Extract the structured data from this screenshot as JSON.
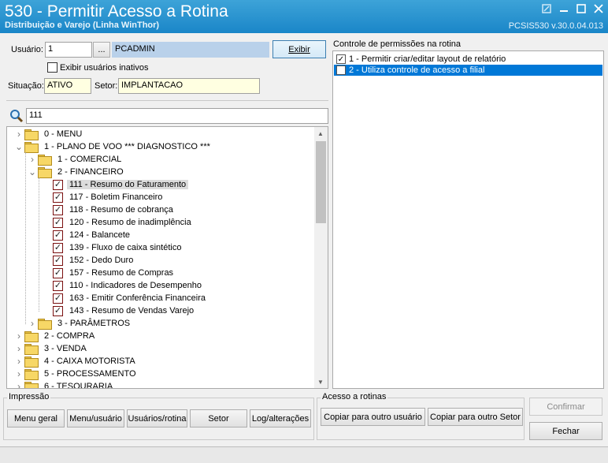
{
  "window": {
    "title": "530 - Permitir Acesso a Rotina",
    "subtitle": "Distribuição e Varejo (Linha WinThor)",
    "version": "PCSIS530  v.30.0.04.013"
  },
  "form": {
    "usuario_label": "Usuário:",
    "usuario_value": "1",
    "lookup_label": "...",
    "usuario_name": "PCADMIN",
    "exibir_label": "Exibir",
    "inativos_label": "Exibir usuários inativos",
    "situacao_label": "Situação:",
    "situacao_value": "ATIVO",
    "setor_label": "Setor:",
    "setor_value": "IMPLANTACAO",
    "search_value": "111"
  },
  "tree": [
    {
      "label": "0 - MENU",
      "level": 0,
      "kind": "folder",
      "arrow": "collapsed"
    },
    {
      "label": "1 - PLANO DE VOO   *** DIAGNOSTICO ***",
      "level": 0,
      "kind": "folder",
      "arrow": "expanded"
    },
    {
      "label": "1 - COMERCIAL",
      "level": 1,
      "kind": "folder",
      "arrow": "collapsed"
    },
    {
      "label": "2 - FINANCEIRO",
      "level": 1,
      "kind": "folder",
      "arrow": "expanded"
    },
    {
      "label": "111 - Resumo do Faturamento",
      "level": 2,
      "kind": "check",
      "checked": true,
      "selected": true
    },
    {
      "label": "117 - Boletim Financeiro",
      "level": 2,
      "kind": "check",
      "checked": true
    },
    {
      "label": "118 - Resumo de cobrança",
      "level": 2,
      "kind": "check",
      "checked": true
    },
    {
      "label": "120 - Resumo de inadimplência",
      "level": 2,
      "kind": "check",
      "checked": true
    },
    {
      "label": "124 - Balancete",
      "level": 2,
      "kind": "check",
      "checked": true
    },
    {
      "label": "139 - Fluxo de caixa sintético",
      "level": 2,
      "kind": "check",
      "checked": true
    },
    {
      "label": "152 - Dedo Duro",
      "level": 2,
      "kind": "check",
      "checked": true
    },
    {
      "label": "157 - Resumo de Compras",
      "level": 2,
      "kind": "check",
      "checked": true
    },
    {
      "label": "110 - Indicadores de Desempenho",
      "level": 2,
      "kind": "check",
      "checked": true
    },
    {
      "label": "163 - Emitir Conferência Financeira",
      "level": 2,
      "kind": "check",
      "checked": true
    },
    {
      "label": "143 - Resumo de Vendas Varejo",
      "level": 2,
      "kind": "check",
      "checked": true
    },
    {
      "label": "3 - PARÂMETROS",
      "level": 1,
      "kind": "folder",
      "arrow": "collapsed"
    },
    {
      "label": "2 - COMPRA",
      "level": 0,
      "kind": "folder",
      "arrow": "collapsed"
    },
    {
      "label": "3 - VENDA",
      "level": 0,
      "kind": "folder",
      "arrow": "collapsed"
    },
    {
      "label": "4 - CAIXA MOTORISTA",
      "level": 0,
      "kind": "folder",
      "arrow": "collapsed"
    },
    {
      "label": "5 - PROCESSAMENTO",
      "level": 0,
      "kind": "folder",
      "arrow": "collapsed"
    },
    {
      "label": "6 - TESOURARIA",
      "level": 0,
      "kind": "folder",
      "arrow": "collapsed"
    }
  ],
  "permissions": {
    "title": "Controle de permissões na rotina",
    "items": [
      {
        "label": "1 - Permitir criar/editar layout de relatório",
        "checked": true,
        "selected": false
      },
      {
        "label": "2 - Utiliza controle de acesso a filial",
        "checked": false,
        "selected": true
      }
    ]
  },
  "impressao": {
    "title": "Impressão",
    "buttons": [
      "Menu geral",
      "Menu/usuário",
      "Usuários/rotina",
      "Setor",
      "Log/alterações"
    ]
  },
  "acesso": {
    "title": "Acesso a rotinas",
    "buttons": [
      "Copiar para outro usuário",
      "Copiar para outro Setor"
    ]
  },
  "actions": {
    "confirmar": "Confirmar",
    "fechar": "Fechar"
  },
  "icons": {
    "search": "magnifier-icon",
    "folder": "folder-icon",
    "minimize": "minimize-icon",
    "maximize": "maximize-icon",
    "close": "close-icon"
  },
  "colors": {
    "titlebar": "#1a86c8",
    "selection": "#0078d7",
    "checkbox_border": "#7a1010"
  }
}
